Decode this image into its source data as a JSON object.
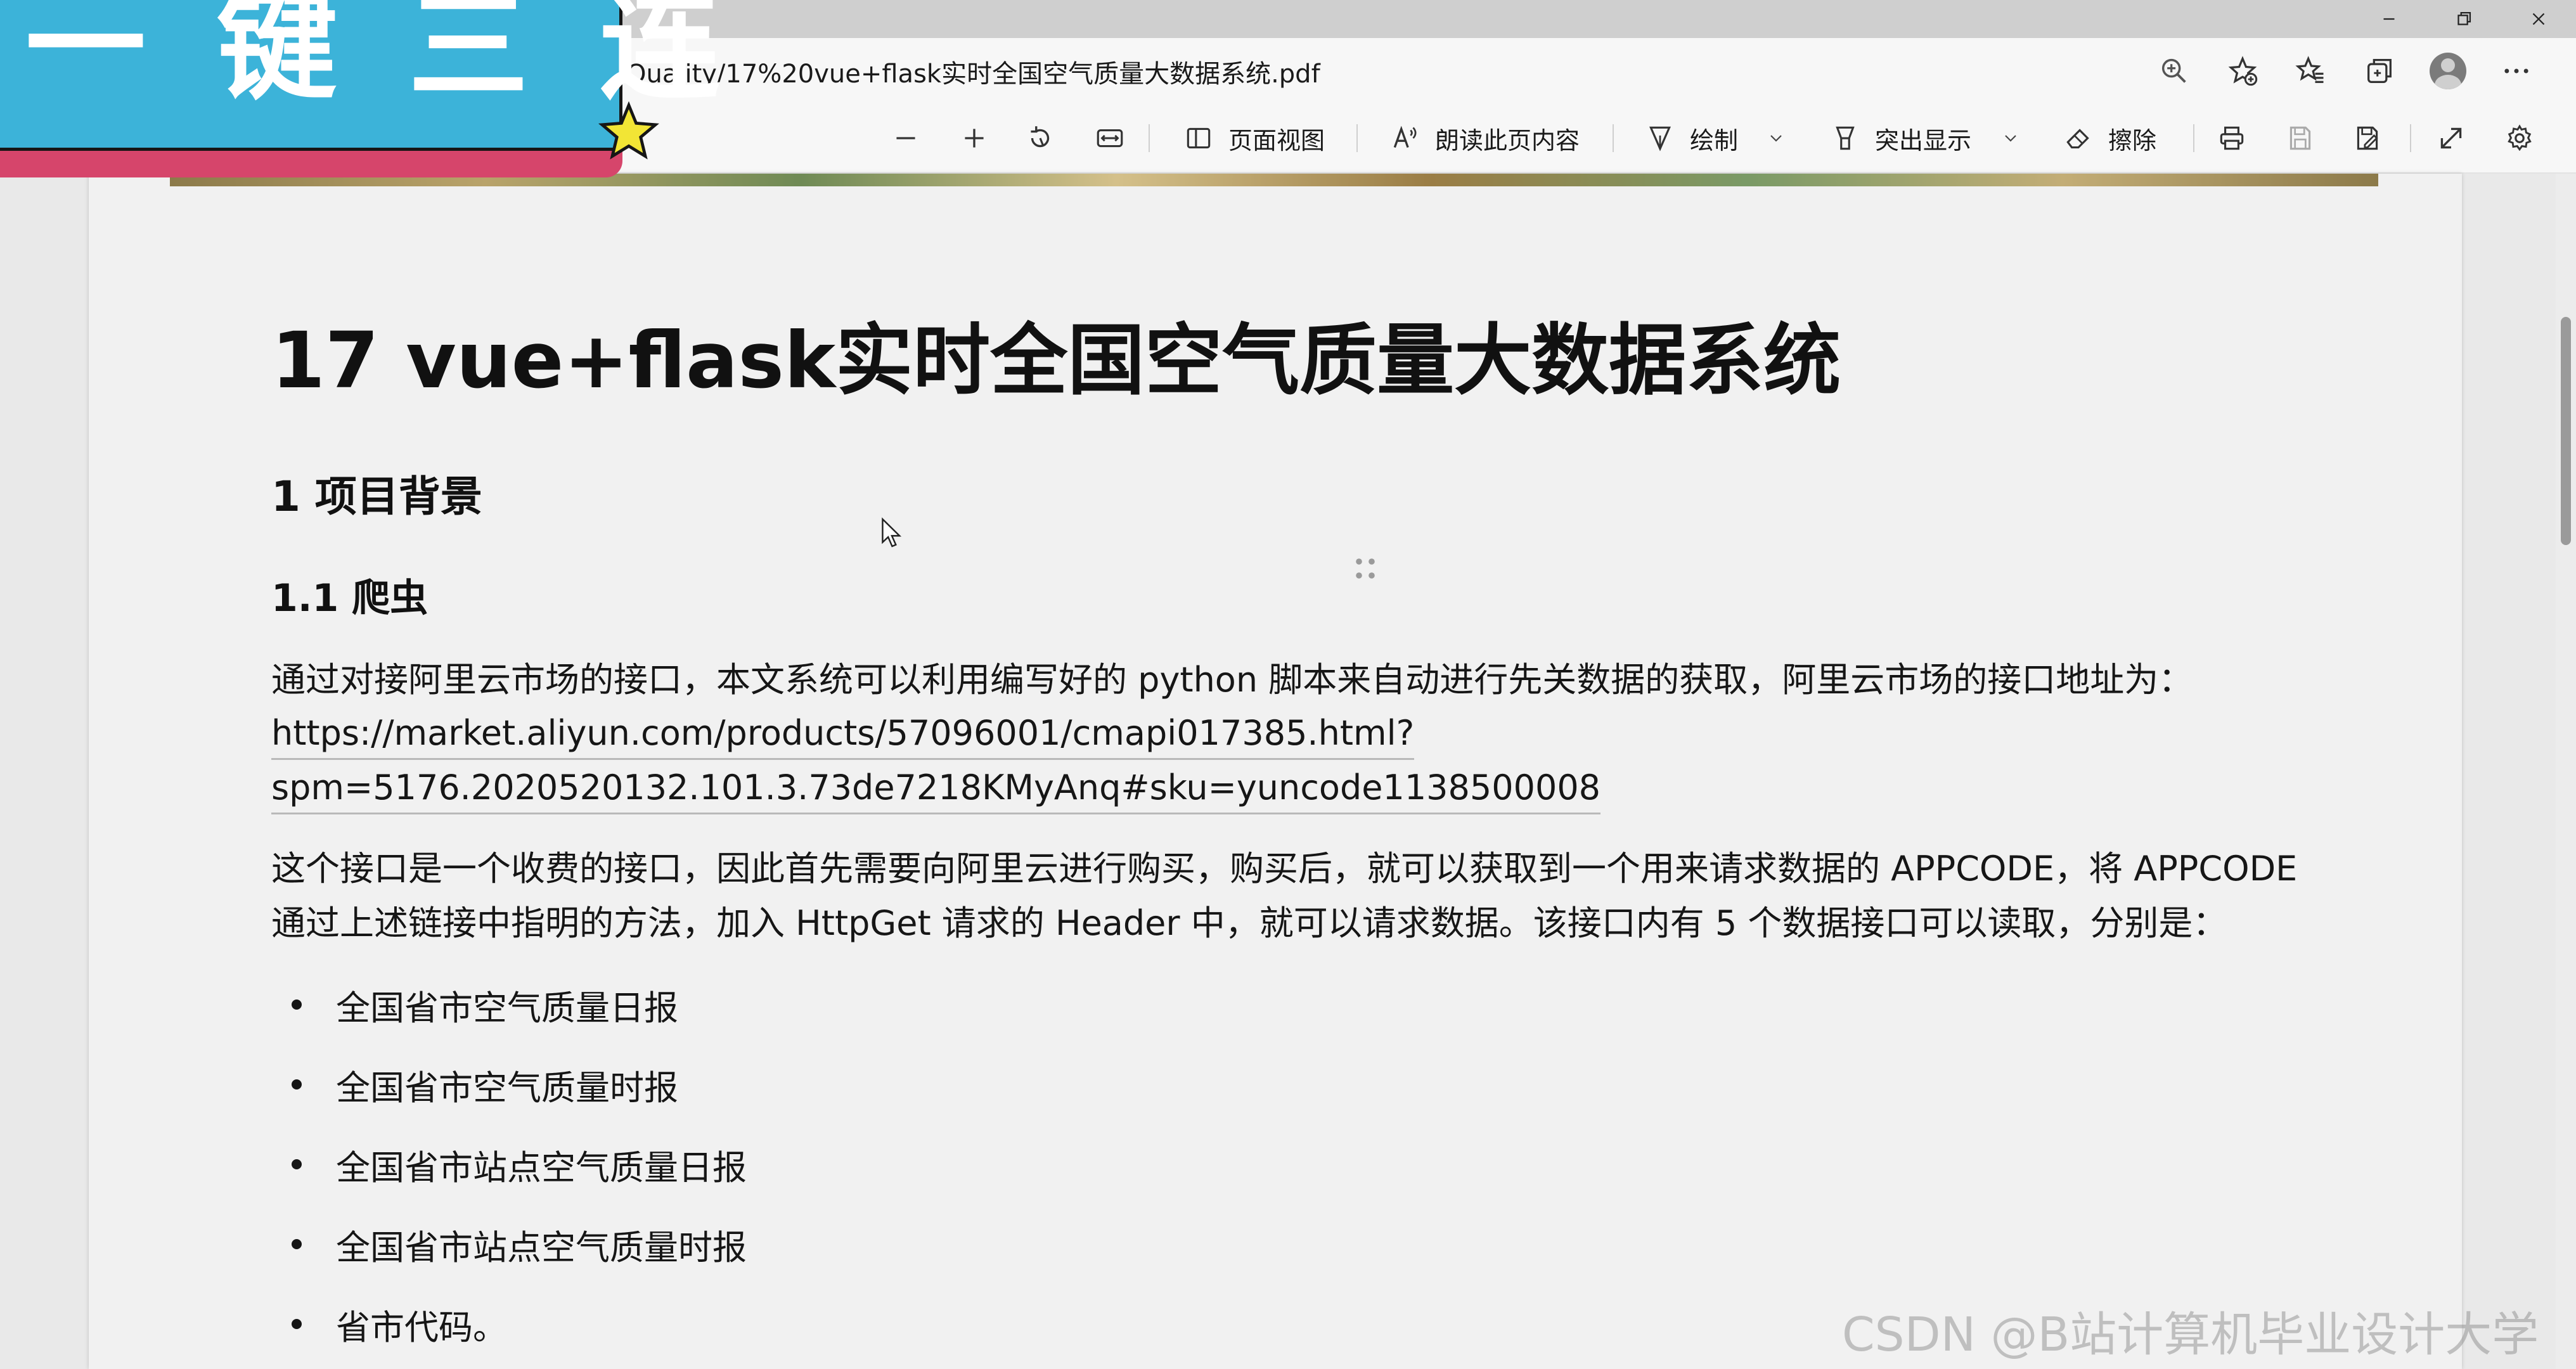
{
  "window": {
    "controls": [
      "minimize-icon",
      "restore-icon",
      "close-icon"
    ]
  },
  "address_bar": {
    "url": "Quality/17%20vue+flask实时全国空气质量大数据系统.pdf",
    "icons": [
      "zoom-icon",
      "add-favorite-icon",
      "favorites-icon",
      "collections-icon",
      "profile-avatar",
      "more-icon"
    ]
  },
  "pdf_toolbar": {
    "zoom_out_icon": "minus-icon",
    "zoom_in_icon": "plus-icon",
    "rotate_icon": "rotate-icon",
    "fit_icon": "fit-width-icon",
    "page_view_label": "页面视图",
    "read_aloud_label": "朗读此页内容",
    "draw_label": "绘制",
    "highlight_label": "突出显示",
    "erase_label": "擦除",
    "right_icons": [
      "print-icon",
      "save-icon",
      "save-as-icon",
      "fullscreen-icon",
      "settings-icon"
    ]
  },
  "banner": {
    "text": "一键三连",
    "colors": {
      "blue": "#3cb3d9",
      "red": "#d6456b",
      "star": "#f2e535"
    }
  },
  "document": {
    "title": "17 vue+flask实时全国空气质量大数据系统",
    "section_1": "1 项目背景",
    "section_1_1": "1.1 爬虫",
    "paragraph_1": "通过对接阿里云市场的接口，本文系统可以利用编写好的 python 脚本来自动进行先关数据的获取，阿里云市场的接口地址为：",
    "link_line_1": "https://market.aliyun.com/products/57096001/cmapi017385.html?",
    "link_line_2": "spm=5176.2020520132.101.3.73de7218KMyAnq#sku=yuncode1138500008",
    "paragraph_2_line_1": "这个接口是一个收费的接口，因此首先需要向阿里云进行购买，购买后，就可以获取到一个用来请求数据的 APPCODE，将 APPCODE",
    "paragraph_2_line_2": "通过上述链接中指明的方法，加入 HttpGet 请求的 Header 中，就可以请求数据。该接口内有 5 个数据接口可以读取，分别是：",
    "bullets": [
      "全国省市空气质量日报",
      "全国省市空气质量时报",
      "全国省市站点空气质量日报",
      "全国省市站点空气质量时报",
      "省市代码。"
    ]
  },
  "watermark": "CSDN @B站计算机毕业设计大学"
}
